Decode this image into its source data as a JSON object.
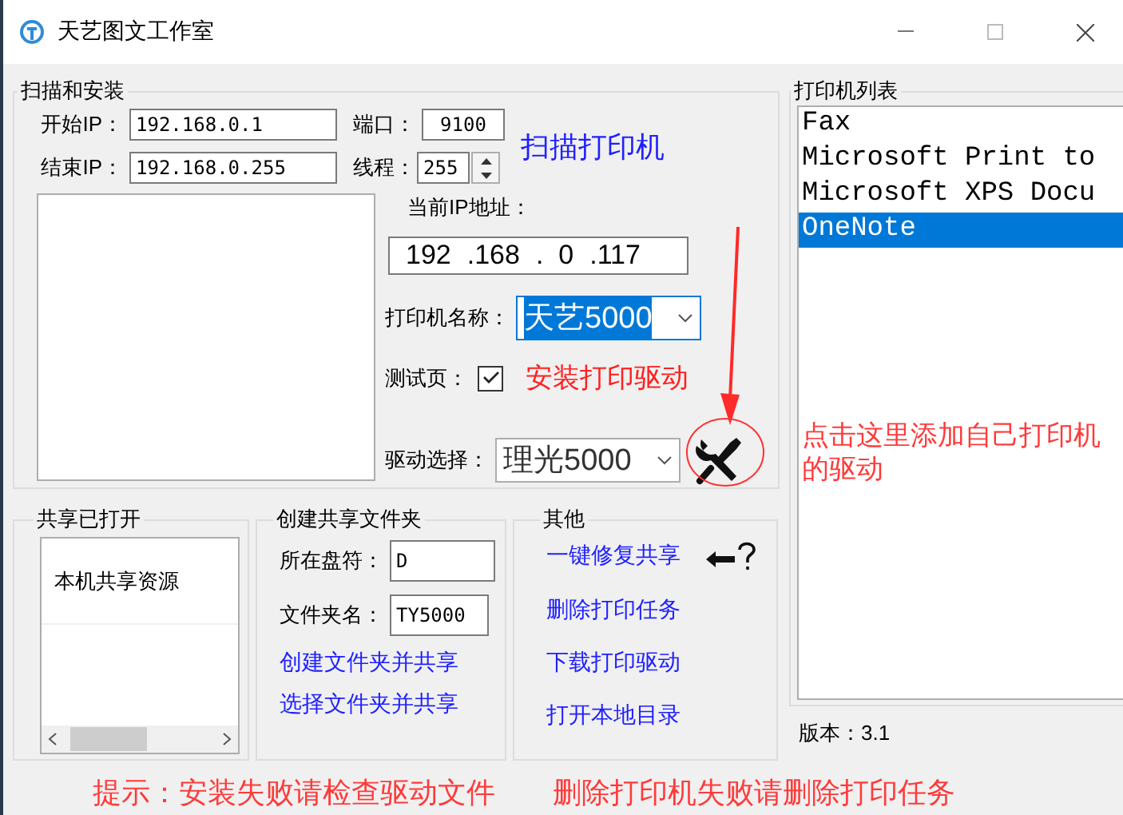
{
  "window": {
    "title": "天艺图文工作室"
  },
  "scan_group": {
    "title": "扫描和安装",
    "start_ip": {
      "label": "开始IP：",
      "value": "192.168.0.1"
    },
    "end_ip": {
      "label": "结束IP：",
      "value": "192.168.0.255"
    },
    "port": {
      "label": "端口：",
      "value": "9100"
    },
    "threads": {
      "label": "线程：",
      "value": "255"
    },
    "scan_link": "扫描打印机",
    "current_ip": {
      "label": "当前IP地址：",
      "octets": [
        "192",
        ".168",
        ".  0",
        ".117"
      ]
    },
    "printer_name": {
      "label": "打印机名称：",
      "value": "天艺5000"
    },
    "test_page": {
      "label": "测试页：",
      "checked": true
    },
    "install_link": "安装打印驱动",
    "driver": {
      "label": "驱动选择：",
      "value": "理光5000"
    }
  },
  "annotation": "点击这里添加自己打印机的驱动",
  "share_group": {
    "title": "共享已打开",
    "items": [
      "本机共享资源"
    ]
  },
  "create_group": {
    "title": "创建共享文件夹",
    "drive": {
      "label": "所在盘符：",
      "value": "D"
    },
    "folder": {
      "label": "文件夹名：",
      "value": "TY5000"
    },
    "links": [
      "创建文件夹并共享",
      "选择文件夹并共享"
    ]
  },
  "other_group": {
    "title": "其他",
    "links": [
      "一键修复共享",
      "删除打印任务",
      "下载打印驱动",
      "打开本地目录"
    ]
  },
  "printer_list": {
    "title": "打印机列表",
    "items": [
      {
        "name": "Fax",
        "selected": false
      },
      {
        "name": "Microsoft Print to",
        "selected": false
      },
      {
        "name": "Microsoft XPS Docu",
        "selected": false
      },
      {
        "name": "OneNote",
        "selected": true
      }
    ]
  },
  "version": "版本：3.1",
  "hints": [
    "提示：安装失败请检查驱动文件",
    "删除打印机失败请删除打印任务"
  ]
}
